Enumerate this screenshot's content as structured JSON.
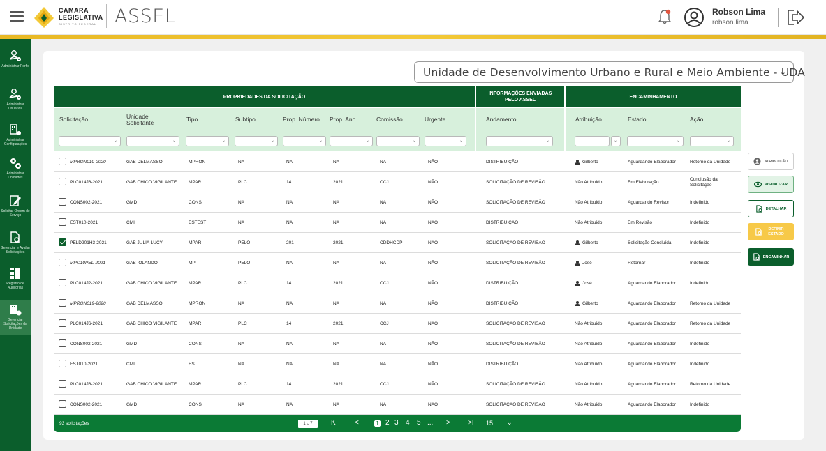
{
  "header": {
    "brand_line1": "CAMARA",
    "brand_line2": "LEGISLATIVA",
    "brand_line3": "DISTRITO FEDERAL",
    "app_name": "ASSEL",
    "user_name": "Robson Lima",
    "user_login": "robson.lima"
  },
  "sidebar": {
    "items": [
      {
        "label": "Administrar Perfis",
        "icon": "user-settings-icon"
      },
      {
        "label": "Administrar Usuários",
        "icon": "users-settings-icon"
      },
      {
        "label": "Administrar Configurações",
        "icon": "building-settings-icon"
      },
      {
        "label": "Administrar Unidades",
        "icon": "gears-icon"
      },
      {
        "label": "Solicitar Ordem de Serviço",
        "icon": "edit-document-icon"
      },
      {
        "label": "Gerenciar e Avaliar Solicitações",
        "icon": "document-search-icon"
      },
      {
        "label": "Registro de Auditorias",
        "icon": "audit-log-icon"
      },
      {
        "label": "Gerenciar Solicitações da Unidade",
        "icon": "unit-requests-icon"
      }
    ]
  },
  "unit_select": {
    "value": "Unidade de Desenvolvimento Urbano e Rural e Meio Ambiente - UDA"
  },
  "table": {
    "group_headers": {
      "props": "PROPRIEDADES DA SOLICITAÇÃO",
      "info": "INFORMAÇÕES ENVIADAS PELO ASSEL",
      "enc": "ENCAMINHAMENTO"
    },
    "columns": {
      "solicitacao": "Solicitação",
      "unidade": "Unidade Solicitante",
      "tipo": "Tipo",
      "subtipo": "Subtipo",
      "pnum": "Prop. Número",
      "pano": "Prop. Ano",
      "comissao": "Comissão",
      "urgente": "Urgente",
      "andamento": "Andamento",
      "atribuicao": "Atribuição",
      "estado": "Estado",
      "acao": "Ação"
    },
    "rows": [
      {
        "sol": "MPRON010-2020",
        "italic": true,
        "checked": false,
        "uni": "GAB DELMASSO",
        "tipo": "MPRON",
        "sub": "NA",
        "pnum": "NA",
        "pano": "NA",
        "com": "NA",
        "urg": "NÃO",
        "and": "DISTRIBUIÇÃO",
        "atr": "Gilberto",
        "person": true,
        "est": "Aguardando Elaborador",
        "acao": "Retorno da Unidade"
      },
      {
        "sol": "PLC014J6-2021",
        "italic": false,
        "checked": false,
        "uni": "GAB CHICO VIGILANTE",
        "tipo": "MPAR",
        "sub": "PLC",
        "pnum": "14",
        "pano": "2021",
        "com": "CCJ",
        "urg": "NÃO",
        "and": "SOLICITAÇÃO DE REVISÃO",
        "atr": "Não Atribuído",
        "person": false,
        "est": "Em Elaboração",
        "acao": "Conclusão da Solicitação"
      },
      {
        "sol": "CONS002-2021",
        "italic": false,
        "checked": false,
        "uni": "GMD",
        "tipo": "CONS",
        "sub": "NA",
        "pnum": "NA",
        "pano": "NA",
        "com": "NA",
        "urg": "NÃO",
        "and": "SOLICITAÇÃO DE REVISÃO",
        "atr": "Não Atribuído",
        "person": false,
        "est": "Aguardando Revisor",
        "acao": "Indefinido"
      },
      {
        "sol": "EST010-2021",
        "italic": false,
        "checked": false,
        "uni": "CMI",
        "tipo": "ESTEST",
        "sub": "NA",
        "pnum": "NA",
        "pano": "NA",
        "com": "NA",
        "urg": "NÃO",
        "and": "DISTRIBUIÇÃO",
        "atr": "Não Atribuído",
        "person": false,
        "est": "Em Revisão",
        "acao": "Indefinido"
      },
      {
        "sol": "PELD201H3-2021",
        "italic": false,
        "checked": true,
        "uni": "GAB JULIA LUCY",
        "tipo": "MPAR",
        "sub": "PELO",
        "pnum": "201",
        "pano": "2021",
        "com": "CDDHCDP",
        "urg": "NÃO",
        "and": "SOLICITAÇÃO DE REVISÃO",
        "atr": "Gilberto",
        "person": true,
        "est": "Solicitação Concluída",
        "acao": "Indefinido"
      },
      {
        "sol": "MPO10PEL-2021",
        "italic": true,
        "checked": false,
        "uni": "GAB IOLANDO",
        "tipo": "MP",
        "sub": "PELO",
        "pnum": "NA",
        "pano": "NA",
        "com": "NA",
        "urg": "NÃO",
        "and": "SOLICITAÇÃO DE REVISÃO",
        "atr": "José",
        "person": true,
        "est": "Retornar",
        "acao": "Indefinido"
      },
      {
        "sol": "PLC014J2-2021",
        "italic": false,
        "checked": false,
        "uni": "GAB CHICO VIGILANTE",
        "tipo": "MPAR",
        "sub": "PLC",
        "pnum": "14",
        "pano": "2021",
        "com": "CCJ",
        "urg": "NÃO",
        "and": "DISTRIBUIÇÃO",
        "atr": "José",
        "person": true,
        "est": "Aguardando Elaborador",
        "acao": "Indefinido"
      },
      {
        "sol": "MPRON019-2020",
        "italic": true,
        "checked": false,
        "uni": "GAB DELMASSO",
        "tipo": "MPRON",
        "sub": "NA",
        "pnum": "NA",
        "pano": "NA",
        "com": "NA",
        "urg": "NÃO",
        "and": "DISTRIBUIÇÃO",
        "atr": "Gilberto",
        "person": true,
        "est": "Aguardando Elaborador",
        "acao": "Retorno da Unidade"
      },
      {
        "sol": "PLC014J6-2021",
        "italic": false,
        "checked": false,
        "uni": "GAB CHICO VIGILANTE",
        "tipo": "MPAR",
        "sub": "PLC",
        "pnum": "14",
        "pano": "2021",
        "com": "CCJ",
        "urg": "NÃO",
        "and": "SOLICITAÇÃO DE REVISÃO",
        "atr": "Não Atribuído",
        "person": false,
        "est": "Aguardando Elaborador",
        "acao": "Retorno da Unidade"
      },
      {
        "sol": "CONS002-2021",
        "italic": false,
        "checked": false,
        "uni": "GMD",
        "tipo": "CONS",
        "sub": "NA",
        "pnum": "NA",
        "pano": "NA",
        "com": "NA",
        "urg": "NÃO",
        "and": "SOLICITAÇÃO DE REVISÃO",
        "atr": "Não Atribuído",
        "person": false,
        "est": "Aguardando Elaborador",
        "acao": "Indefinido"
      },
      {
        "sol": "EST010-2021",
        "italic": false,
        "checked": false,
        "uni": "CMI",
        "tipo": "EST",
        "sub": "NA",
        "pnum": "NA",
        "pano": "NA",
        "com": "NA",
        "urg": "NÃO",
        "and": "DISTRIBUIÇÃO",
        "atr": "Não Atribuído",
        "person": false,
        "est": "Aguardando Elaborador",
        "acao": "Indefinido"
      },
      {
        "sol": "PLC014J6-2021",
        "italic": false,
        "checked": false,
        "uni": "GAB CHICO VIGILANTE",
        "tipo": "MPAR",
        "sub": "PLC",
        "pnum": "14",
        "pano": "2021",
        "com": "CCJ",
        "urg": "NÃO",
        "and": "SOLICITAÇÃO DE REVISÃO",
        "atr": "Não Atribuído",
        "person": false,
        "est": "Aguardando Elaborador",
        "acao": "Retorno da Unidade"
      },
      {
        "sol": "CONS002-2021",
        "italic": false,
        "checked": false,
        "uni": "GMD",
        "tipo": "CONS",
        "sub": "NA",
        "pnum": "NA",
        "pano": "NA",
        "com": "NA",
        "urg": "NÃO",
        "and": "SOLICITAÇÃO DE REVISÃO",
        "atr": "Não Atribuído",
        "person": false,
        "est": "Aguardando Elaborador",
        "acao": "Indefinido"
      }
    ]
  },
  "footer": {
    "count": "93 solicitações",
    "page": "1",
    "page_of": "de",
    "page_total": "7",
    "first": "K",
    "prev": "<",
    "pages": [
      "1",
      "2",
      "3",
      "4",
      "5"
    ],
    "ellipsis": "...",
    "next": ">",
    "last": ">I",
    "per_page": "15"
  },
  "actions": [
    {
      "label": "ATRIBUIÇÃO",
      "icon": "person-circle-icon",
      "bg": "#ffffff",
      "fg": "#666666",
      "border": "#cfcfcf"
    },
    {
      "label": "VISUALIZAR",
      "icon": "eye-icon",
      "bg": "#e2f3e6",
      "fg": "#0b5e2c",
      "border": "#6fb182"
    },
    {
      "label": "DETALHAR",
      "icon": "document-search-icon",
      "bg": "#ffffff",
      "fg": "#0b5e2c",
      "border": "#0b5e2c"
    },
    {
      "label": "DEFINIR ESTADO",
      "icon": "document-edit-icon",
      "bg": "#f7c948",
      "fg": "#ffffff",
      "border": "#f7c948"
    },
    {
      "label": "ENCAMINHAR",
      "icon": "document-forward-icon",
      "bg": "#0b5e2c",
      "fg": "#ffffff",
      "border": "#0b5e2c"
    }
  ],
  "colors": {
    "primary": "#0b5e2c",
    "gold": "#f3c937",
    "header_light": "#d7f0dc"
  }
}
